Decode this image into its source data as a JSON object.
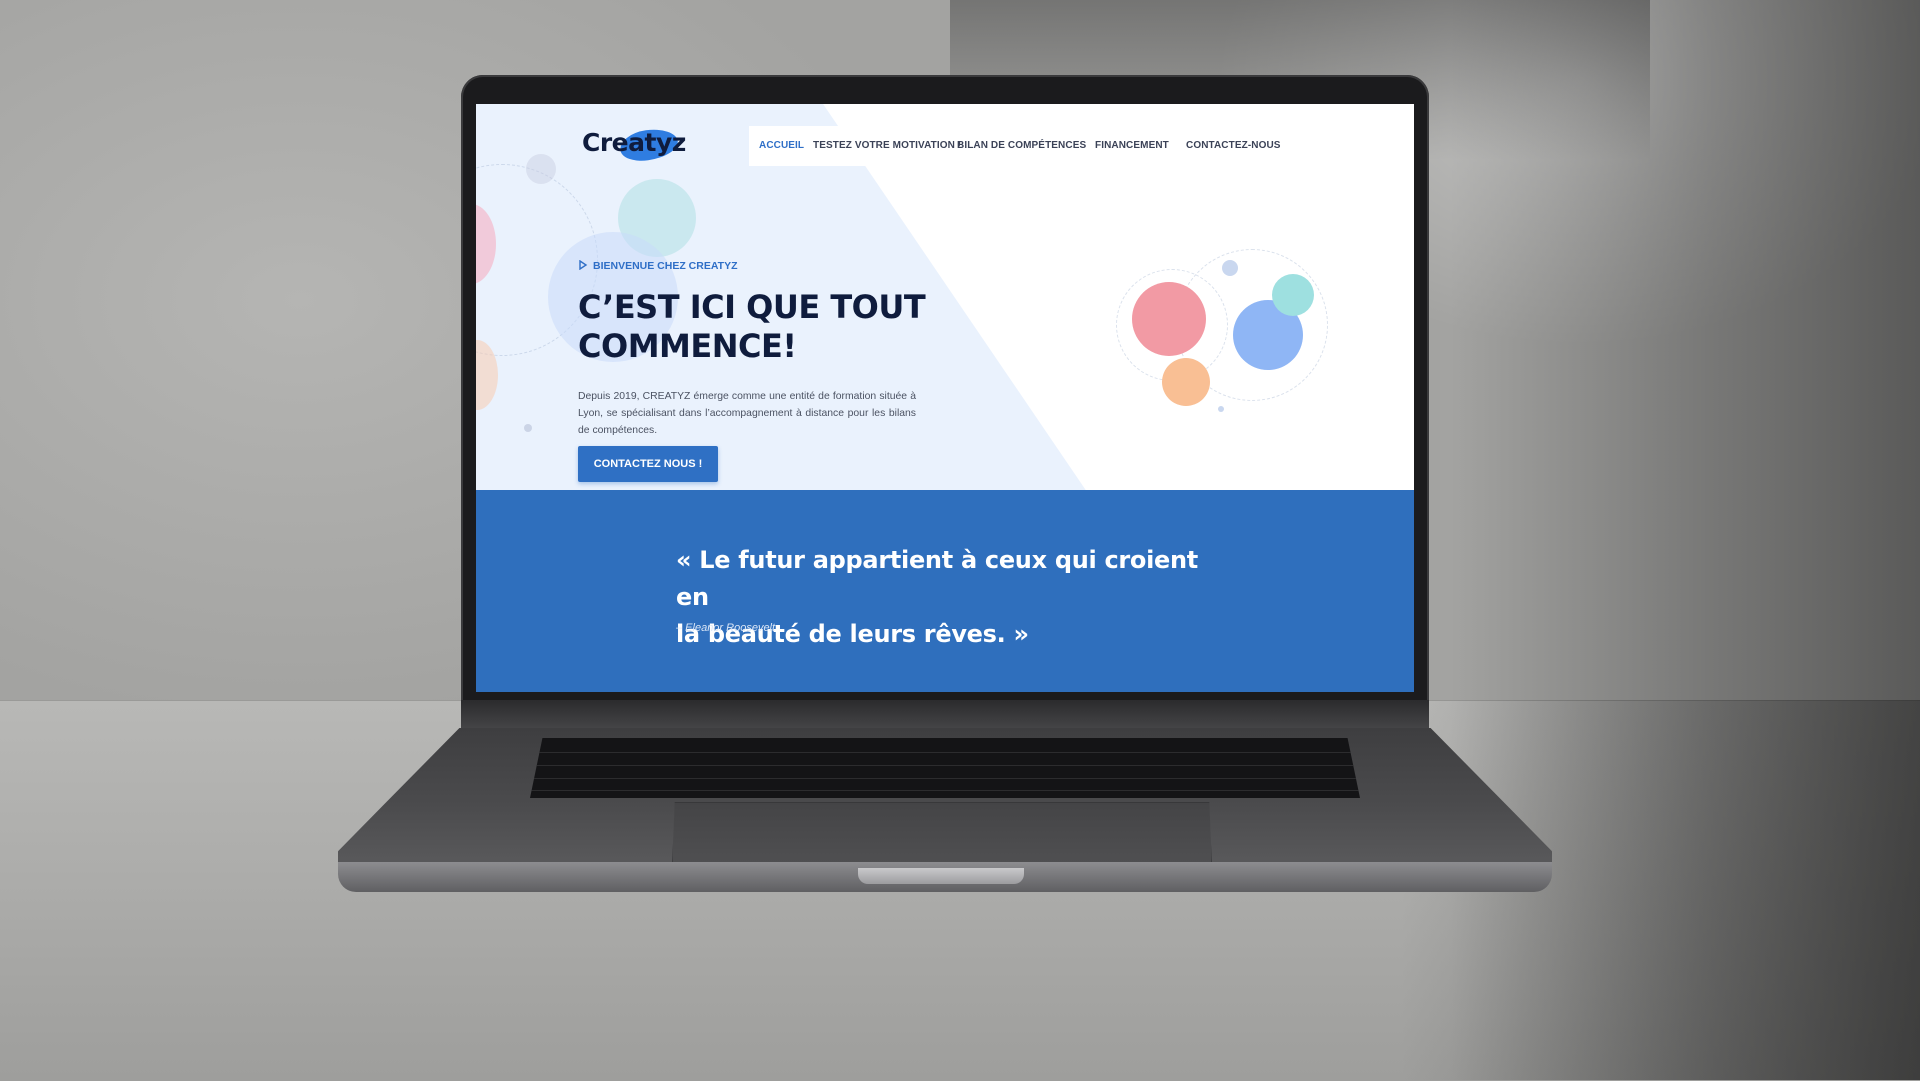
{
  "brand": {
    "logo_text": "Creatyz",
    "accent": "#2f6fc7",
    "band_color": "#2f6fbd"
  },
  "nav": {
    "items": [
      {
        "label": "ACCUEIL",
        "active": true
      },
      {
        "label": "TESTEZ VOTRE MOTIVATION !",
        "active": false
      },
      {
        "label": "BILAN DE COMPÉTENCES",
        "active": false
      },
      {
        "label": "FINANCEMENT",
        "active": false
      },
      {
        "label": "CONTACTEZ-NOUS",
        "active": false
      }
    ]
  },
  "hero": {
    "eyebrow": "BIENVENUE CHEZ CREATYZ",
    "headline_line1": "C’EST ICI QUE TOUT",
    "headline_line2": "COMMENCE!",
    "intro": "Depuis 2019, CREATYZ émerge comme une entité de formation située à Lyon, se spécialisant dans l’accompagnement à distance pour les bilans de compétences.",
    "cta_label": "CONTACTEZ NOUS !"
  },
  "quote": {
    "line1": "« Le futur appartient à ceux qui croient en",
    "line2": "la beauté de leurs rêves. »",
    "author": "– Eleanor Roosevelt"
  },
  "icons": {
    "eyebrow_icon": "sparkle-icon"
  }
}
